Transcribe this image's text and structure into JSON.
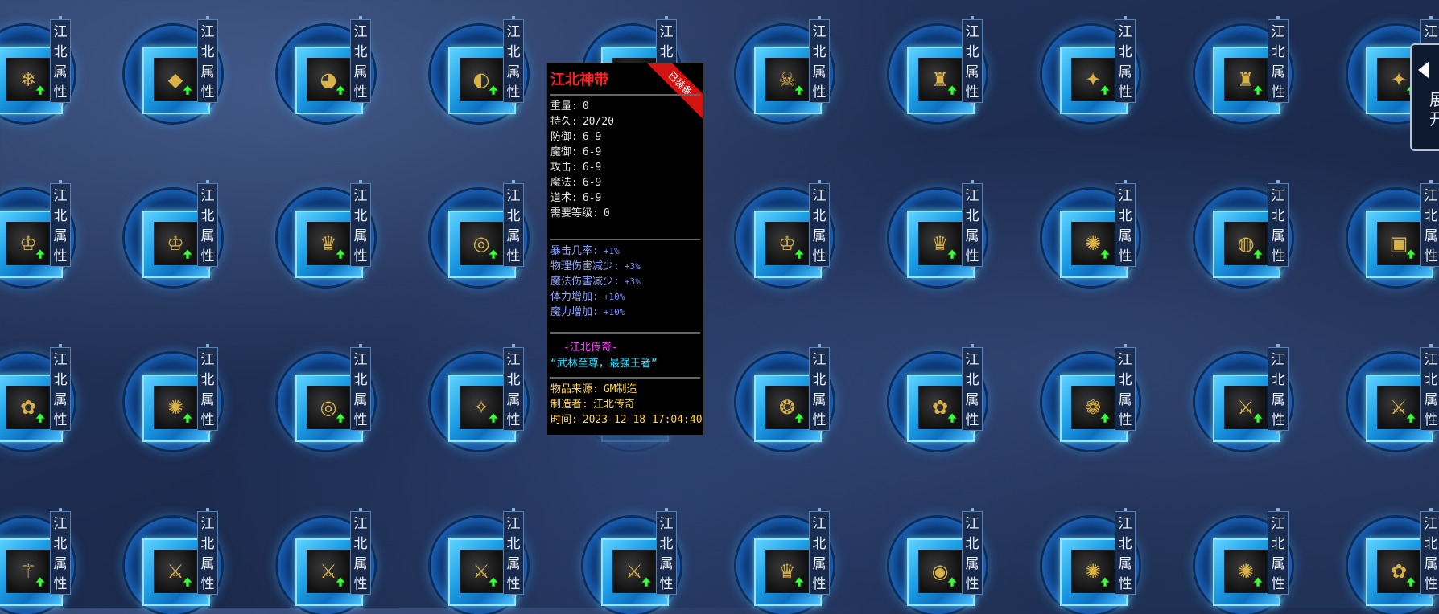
{
  "tag_text": [
    "江",
    "北",
    "属",
    "性"
  ],
  "columns": [
    0,
    1,
    2,
    3,
    4,
    5,
    6,
    7,
    8,
    9
  ],
  "rows": [
    {
      "items": [
        {
          "glyph": "❄",
          "hidden": false
        },
        {
          "glyph": "◆",
          "hidden": false
        },
        {
          "glyph": "◕",
          "hidden": false
        },
        {
          "glyph": "◐",
          "hidden": false
        },
        {
          "glyph": "♛",
          "hidden": false
        },
        {
          "glyph": "☠",
          "hidden": false
        },
        {
          "glyph": "♜",
          "hidden": false
        },
        {
          "glyph": "✦",
          "hidden": false
        },
        {
          "glyph": "♜",
          "hidden": false
        },
        {
          "glyph": "✦",
          "hidden": false
        }
      ]
    },
    {
      "items": [
        {
          "glyph": "♔",
          "hidden": false
        },
        {
          "glyph": "♔",
          "hidden": false
        },
        {
          "glyph": "♛",
          "hidden": false
        },
        {
          "glyph": "◎",
          "hidden": false
        },
        {
          "glyph": "",
          "hidden": true
        },
        {
          "glyph": "♔",
          "hidden": false
        },
        {
          "glyph": "♛",
          "hidden": false
        },
        {
          "glyph": "✺",
          "hidden": false
        },
        {
          "glyph": "◍",
          "hidden": false
        },
        {
          "glyph": "▣",
          "hidden": false
        }
      ]
    },
    {
      "items": [
        {
          "glyph": "✿",
          "hidden": false
        },
        {
          "glyph": "✺",
          "hidden": false
        },
        {
          "glyph": "◎",
          "hidden": false
        },
        {
          "glyph": "✧",
          "hidden": false
        },
        {
          "glyph": "",
          "hidden": true
        },
        {
          "glyph": "❂",
          "hidden": false
        },
        {
          "glyph": "✿",
          "hidden": false
        },
        {
          "glyph": "❁",
          "hidden": false
        },
        {
          "glyph": "⚔",
          "hidden": false
        },
        {
          "glyph": "⚔",
          "hidden": false
        }
      ]
    },
    {
      "items": [
        {
          "glyph": "⚚",
          "hidden": false
        },
        {
          "glyph": "⚔",
          "hidden": false
        },
        {
          "glyph": "⚔",
          "hidden": false
        },
        {
          "glyph": "⚔",
          "hidden": false
        },
        {
          "glyph": "⚔",
          "hidden": false
        },
        {
          "glyph": "♛",
          "hidden": false
        },
        {
          "glyph": "◉",
          "hidden": false
        },
        {
          "glyph": "✺",
          "hidden": false
        },
        {
          "glyph": "✺",
          "hidden": false
        },
        {
          "glyph": "✿",
          "hidden": false
        }
      ]
    }
  ],
  "tooltip": {
    "title": "江北神带",
    "ribbon": "已装备",
    "stats": [
      {
        "k": "重量:",
        "v": "0"
      },
      {
        "k": "持久:",
        "v": "20/20"
      },
      {
        "k": "防御:",
        "v": "6-9"
      },
      {
        "k": "魔御:",
        "v": "6-9"
      },
      {
        "k": "攻击:",
        "v": "6-9"
      },
      {
        "k": "魔法:",
        "v": "6-9"
      },
      {
        "k": "道术:",
        "v": "6-9"
      },
      {
        "k": "需要等级:",
        "v": "0"
      }
    ],
    "extras": [
      {
        "k": "暴击几率:",
        "v": "+1%"
      },
      {
        "k": "物理伤害减少:",
        "v": "+3%"
      },
      {
        "k": "魔法伤害减少:",
        "v": "+3%"
      },
      {
        "k": "体力增加:",
        "v": "+10%"
      },
      {
        "k": "魔力增加:",
        "v": "+10%"
      }
    ],
    "brand": "-江北传奇-",
    "slogan": "“武林至尊，最强王者”",
    "origin": [
      {
        "k": "物品来源:",
        "v": "GM制造"
      },
      {
        "k": "制造者:",
        "v": "江北传奇"
      },
      {
        "k": "时间:",
        "v": "2023-12-18 17:04:40"
      }
    ]
  },
  "edge_panel": {
    "text": "展开"
  }
}
